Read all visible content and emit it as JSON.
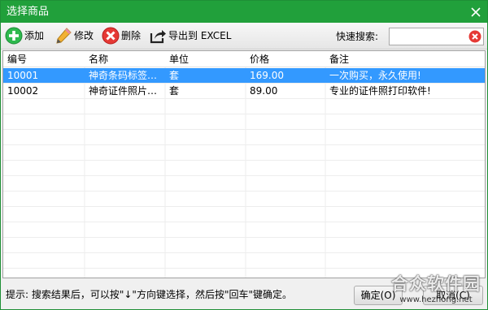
{
  "window": {
    "title": "选择商品"
  },
  "toolbar": {
    "add_label": "添加",
    "edit_label": "修改",
    "delete_label": "删除",
    "export_label": "导出到 EXCEL",
    "search_label": "快速搜索:",
    "search_value": ""
  },
  "table": {
    "columns": [
      "编号",
      "名称",
      "单位",
      "价格",
      "备注"
    ],
    "rows": [
      [
        "10001",
        "神奇条码标签…",
        "套",
        "169.00",
        "一次购买，永久使用!"
      ],
      [
        "10002",
        "神奇证件照片…",
        "套",
        "89.00",
        "专业的证件照打印软件!"
      ]
    ],
    "selected_row": 0
  },
  "status": {
    "hint": "提示: 搜索结果后，可以按\"↓\"方向键选择，然后按\"回车\"键确定。",
    "confirm_label": "确定(O)",
    "cancel_label": "取消(C)"
  },
  "watermark": {
    "text": "合众软件园",
    "url": "www.hezhong.net"
  },
  "colors": {
    "titlebar": "#21a03b",
    "selection": "#3399ff",
    "add_icon": "#2db94d",
    "delete_icon": "#e53935"
  },
  "icons": [
    "add-icon",
    "pencil-icon",
    "delete-icon",
    "export-icon",
    "clear-search-icon",
    "close-icon"
  ]
}
